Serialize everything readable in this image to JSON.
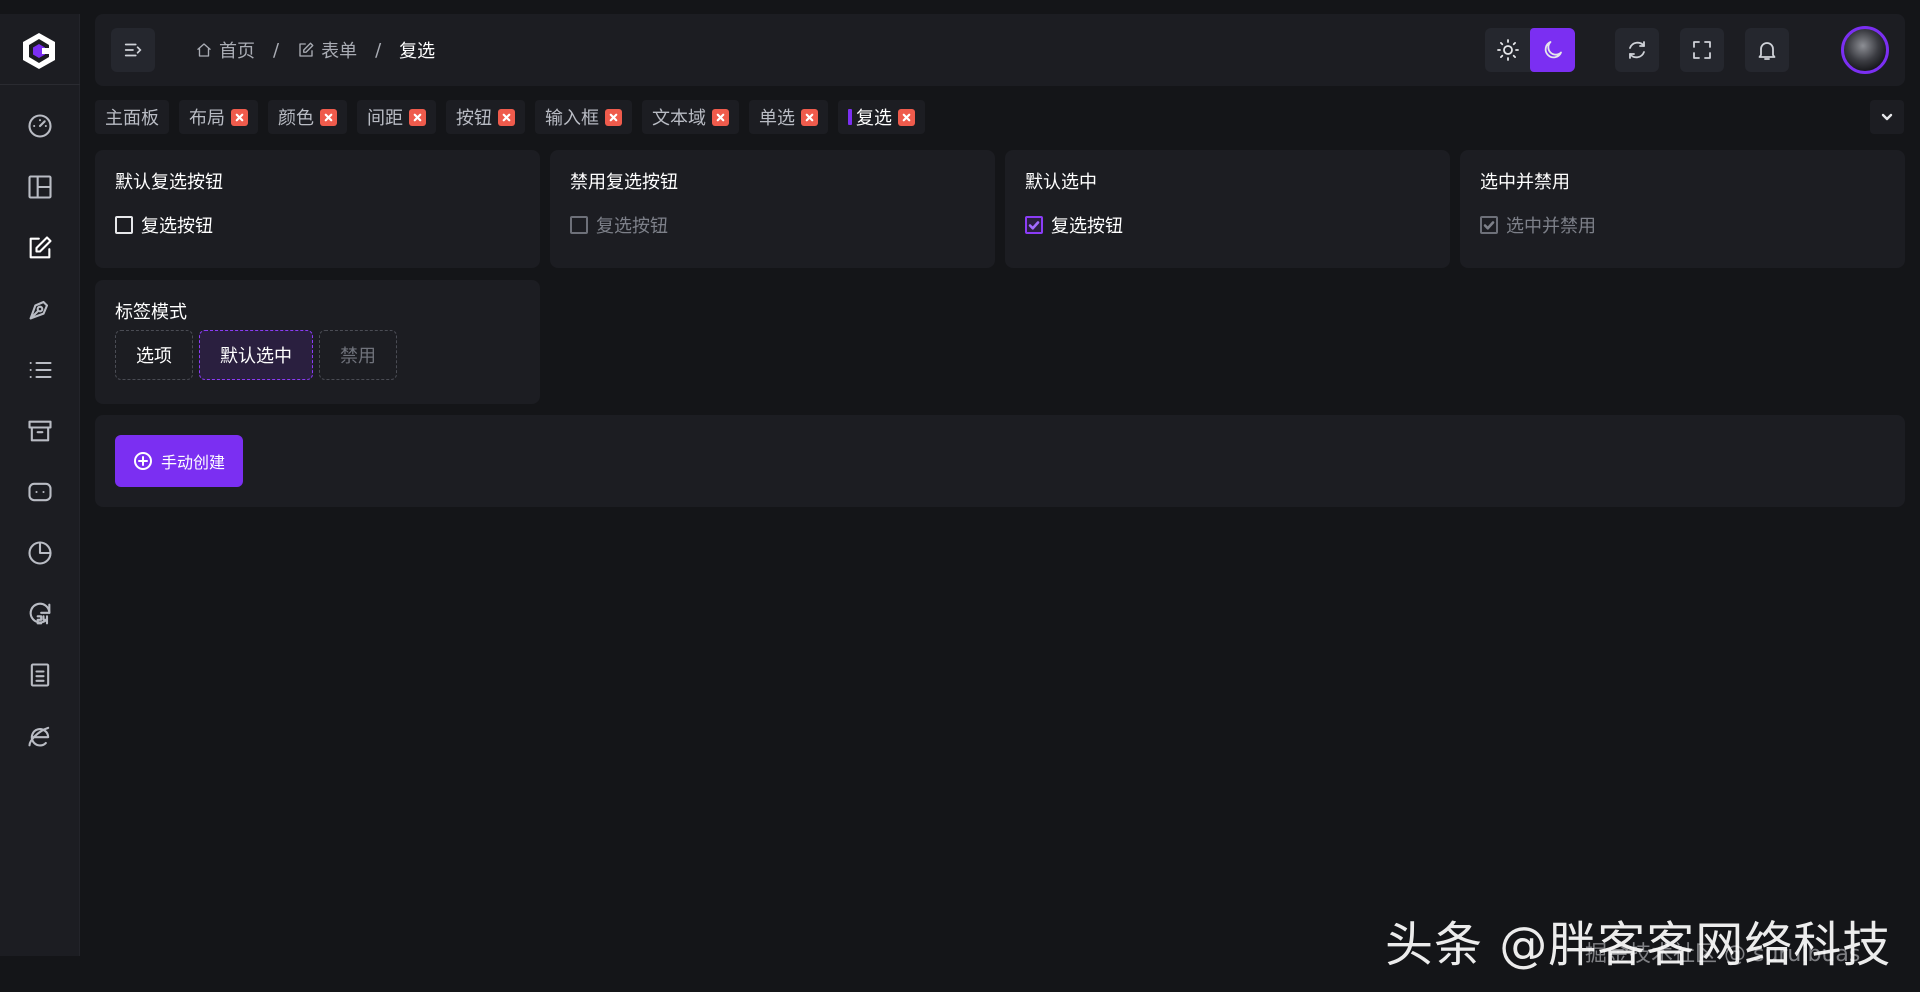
{
  "app": {
    "brand_color": "#7b2ff2",
    "logo_icon": "hexagon-c-logo"
  },
  "sidebar": {
    "items": [
      {
        "icon": "dashboard-gauge-icon",
        "active": false
      },
      {
        "icon": "layout-icon",
        "active": false
      },
      {
        "icon": "form-edit-icon",
        "active": true
      },
      {
        "icon": "pen-nib-icon",
        "active": false
      },
      {
        "icon": "list-icon",
        "active": false
      },
      {
        "icon": "archive-box-icon",
        "active": false
      },
      {
        "icon": "chat-bubble-icon",
        "active": false
      },
      {
        "icon": "pie-chart-icon",
        "active": false
      },
      {
        "icon": "24-hours-icon",
        "active": false
      },
      {
        "icon": "document-icon",
        "active": false
      },
      {
        "icon": "ie-browser-icon",
        "active": false
      }
    ]
  },
  "header": {
    "breadcrumb": [
      {
        "label": "首页",
        "icon": "home-icon"
      },
      {
        "label": "表单",
        "icon": "form-edit-icon"
      },
      {
        "label": "复选",
        "icon": ""
      }
    ],
    "separator": "/",
    "theme": {
      "light_icon": "sun-icon",
      "dark_icon": "moon-icon",
      "selected": "dark"
    },
    "actions": [
      "refresh-icon",
      "fullscreen-icon",
      "bell-icon"
    ]
  },
  "tabs": [
    {
      "label": "主面板",
      "closable": false,
      "active": false
    },
    {
      "label": "布局",
      "closable": true,
      "active": false
    },
    {
      "label": "颜色",
      "closable": true,
      "active": false
    },
    {
      "label": "间距",
      "closable": true,
      "active": false
    },
    {
      "label": "按钮",
      "closable": true,
      "active": false
    },
    {
      "label": "输入框",
      "closable": true,
      "active": false
    },
    {
      "label": "文本域",
      "closable": true,
      "active": false
    },
    {
      "label": "单选",
      "closable": true,
      "active": false
    },
    {
      "label": "复选",
      "closable": true,
      "active": true
    }
  ],
  "cards": {
    "default": {
      "title": "默认复选按钮",
      "checkbox_label": "复选按钮"
    },
    "disabled": {
      "title": "禁用复选按钮",
      "checkbox_label": "复选按钮"
    },
    "checked": {
      "title": "默认选中",
      "checkbox_label": "复选按钮"
    },
    "checked_disabled": {
      "title": "选中并禁用",
      "checkbox_label": "选中并禁用"
    },
    "tag_mode": {
      "title": "标签模式",
      "tags": [
        {
          "label": "选项",
          "state": "normal"
        },
        {
          "label": "默认选中",
          "state": "selected"
        },
        {
          "label": "禁用",
          "state": "disabled"
        }
      ]
    }
  },
  "actions": {
    "create_label": "手动创建"
  },
  "watermark": {
    "main": "头条 @胖客客网络科技",
    "sub": "掘金技术社区 @ suruibuas"
  }
}
